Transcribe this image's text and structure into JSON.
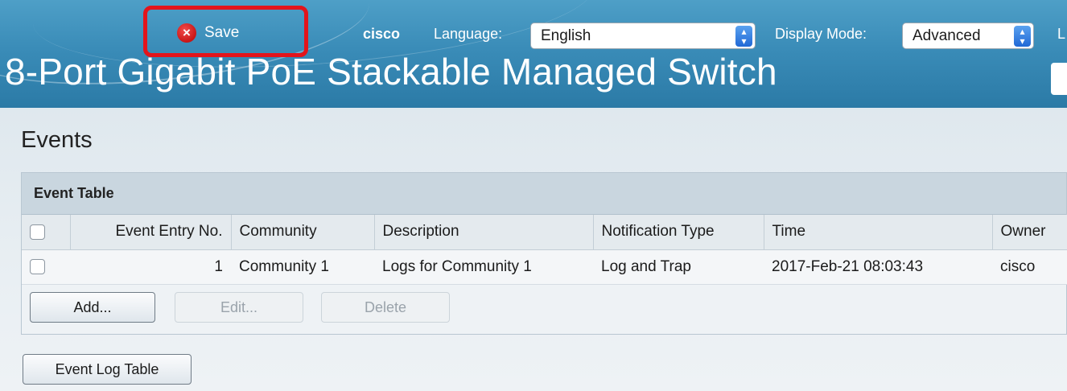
{
  "header": {
    "save_label": "Save",
    "user": "cisco",
    "language_label": "Language:",
    "language_value": "English",
    "display_mode_label": "Display Mode:",
    "display_mode_value": "Advanced",
    "cut_text": "L",
    "product_title": "8-Port Gigabit PoE Stackable Managed Switch"
  },
  "page": {
    "title": "Events"
  },
  "event_table": {
    "title": "Event Table",
    "columns": [
      "Event Entry No.",
      "Community",
      "Description",
      "Notification Type",
      "Time",
      "Owner"
    ],
    "rows": [
      {
        "entry_no": "1",
        "community": "Community 1",
        "description": "Logs for Community 1",
        "notification_type": "Log and Trap",
        "time": "2017-Feb-21 08:03:43",
        "owner": "cisco"
      }
    ],
    "buttons": {
      "add": "Add...",
      "edit": "Edit...",
      "delete": "Delete"
    }
  },
  "event_log_button": "Event Log Table",
  "colors": {
    "header_blue": "#3a8cb8",
    "highlight_red": "#e3141b"
  }
}
